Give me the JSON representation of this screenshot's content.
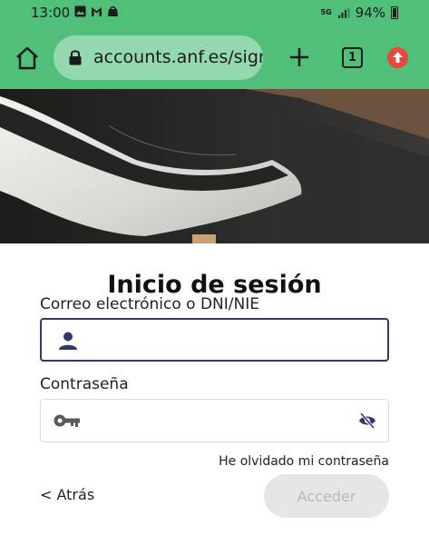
{
  "status_bar": {
    "time": "13:00",
    "network": "5G",
    "battery": "94%"
  },
  "browser": {
    "url": "accounts.anf.es/sign",
    "tab_count": "1"
  },
  "login": {
    "title": "Inicio de sesión",
    "email_label": "Correo electrónico o DNI/NIE",
    "email_value": "",
    "password_label": "Contraseña",
    "password_value": "",
    "forgot_link": "He olvidado mi contraseña",
    "back_link": "< Atrás",
    "submit_label": "Acceder"
  },
  "colors": {
    "toolbar": "#4fbf7a",
    "urlbar": "#93d8ae",
    "field_border_focus": "#2f3a6b",
    "icon_navy": "#2f3a6b",
    "update_badge": "#e8493c",
    "button_disabled_bg": "#e6e6e6",
    "button_disabled_text": "#b9b9b9"
  }
}
